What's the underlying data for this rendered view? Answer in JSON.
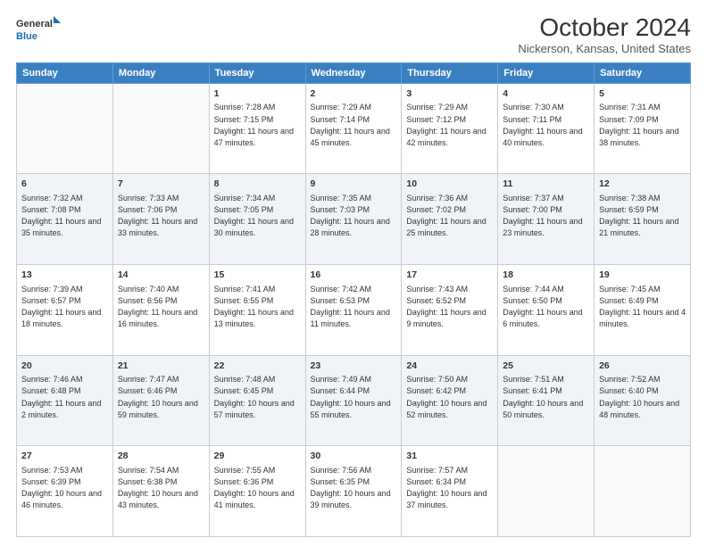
{
  "header": {
    "logo_line1": "General",
    "logo_line2": "Blue",
    "title": "October 2024",
    "subtitle": "Nickerson, Kansas, United States"
  },
  "weekdays": [
    "Sunday",
    "Monday",
    "Tuesday",
    "Wednesday",
    "Thursday",
    "Friday",
    "Saturday"
  ],
  "weeks": [
    [
      {
        "day": "",
        "info": ""
      },
      {
        "day": "",
        "info": ""
      },
      {
        "day": "1",
        "info": "Sunrise: 7:28 AM\nSunset: 7:15 PM\nDaylight: 11 hours and 47 minutes."
      },
      {
        "day": "2",
        "info": "Sunrise: 7:29 AM\nSunset: 7:14 PM\nDaylight: 11 hours and 45 minutes."
      },
      {
        "day": "3",
        "info": "Sunrise: 7:29 AM\nSunset: 7:12 PM\nDaylight: 11 hours and 42 minutes."
      },
      {
        "day": "4",
        "info": "Sunrise: 7:30 AM\nSunset: 7:11 PM\nDaylight: 11 hours and 40 minutes."
      },
      {
        "day": "5",
        "info": "Sunrise: 7:31 AM\nSunset: 7:09 PM\nDaylight: 11 hours and 38 minutes."
      }
    ],
    [
      {
        "day": "6",
        "info": "Sunrise: 7:32 AM\nSunset: 7:08 PM\nDaylight: 11 hours and 35 minutes."
      },
      {
        "day": "7",
        "info": "Sunrise: 7:33 AM\nSunset: 7:06 PM\nDaylight: 11 hours and 33 minutes."
      },
      {
        "day": "8",
        "info": "Sunrise: 7:34 AM\nSunset: 7:05 PM\nDaylight: 11 hours and 30 minutes."
      },
      {
        "day": "9",
        "info": "Sunrise: 7:35 AM\nSunset: 7:03 PM\nDaylight: 11 hours and 28 minutes."
      },
      {
        "day": "10",
        "info": "Sunrise: 7:36 AM\nSunset: 7:02 PM\nDaylight: 11 hours and 25 minutes."
      },
      {
        "day": "11",
        "info": "Sunrise: 7:37 AM\nSunset: 7:00 PM\nDaylight: 11 hours and 23 minutes."
      },
      {
        "day": "12",
        "info": "Sunrise: 7:38 AM\nSunset: 6:59 PM\nDaylight: 11 hours and 21 minutes."
      }
    ],
    [
      {
        "day": "13",
        "info": "Sunrise: 7:39 AM\nSunset: 6:57 PM\nDaylight: 11 hours and 18 minutes."
      },
      {
        "day": "14",
        "info": "Sunrise: 7:40 AM\nSunset: 6:56 PM\nDaylight: 11 hours and 16 minutes."
      },
      {
        "day": "15",
        "info": "Sunrise: 7:41 AM\nSunset: 6:55 PM\nDaylight: 11 hours and 13 minutes."
      },
      {
        "day": "16",
        "info": "Sunrise: 7:42 AM\nSunset: 6:53 PM\nDaylight: 11 hours and 11 minutes."
      },
      {
        "day": "17",
        "info": "Sunrise: 7:43 AM\nSunset: 6:52 PM\nDaylight: 11 hours and 9 minutes."
      },
      {
        "day": "18",
        "info": "Sunrise: 7:44 AM\nSunset: 6:50 PM\nDaylight: 11 hours and 6 minutes."
      },
      {
        "day": "19",
        "info": "Sunrise: 7:45 AM\nSunset: 6:49 PM\nDaylight: 11 hours and 4 minutes."
      }
    ],
    [
      {
        "day": "20",
        "info": "Sunrise: 7:46 AM\nSunset: 6:48 PM\nDaylight: 11 hours and 2 minutes."
      },
      {
        "day": "21",
        "info": "Sunrise: 7:47 AM\nSunset: 6:46 PM\nDaylight: 10 hours and 59 minutes."
      },
      {
        "day": "22",
        "info": "Sunrise: 7:48 AM\nSunset: 6:45 PM\nDaylight: 10 hours and 57 minutes."
      },
      {
        "day": "23",
        "info": "Sunrise: 7:49 AM\nSunset: 6:44 PM\nDaylight: 10 hours and 55 minutes."
      },
      {
        "day": "24",
        "info": "Sunrise: 7:50 AM\nSunset: 6:42 PM\nDaylight: 10 hours and 52 minutes."
      },
      {
        "day": "25",
        "info": "Sunrise: 7:51 AM\nSunset: 6:41 PM\nDaylight: 10 hours and 50 minutes."
      },
      {
        "day": "26",
        "info": "Sunrise: 7:52 AM\nSunset: 6:40 PM\nDaylight: 10 hours and 48 minutes."
      }
    ],
    [
      {
        "day": "27",
        "info": "Sunrise: 7:53 AM\nSunset: 6:39 PM\nDaylight: 10 hours and 46 minutes."
      },
      {
        "day": "28",
        "info": "Sunrise: 7:54 AM\nSunset: 6:38 PM\nDaylight: 10 hours and 43 minutes."
      },
      {
        "day": "29",
        "info": "Sunrise: 7:55 AM\nSunset: 6:36 PM\nDaylight: 10 hours and 41 minutes."
      },
      {
        "day": "30",
        "info": "Sunrise: 7:56 AM\nSunset: 6:35 PM\nDaylight: 10 hours and 39 minutes."
      },
      {
        "day": "31",
        "info": "Sunrise: 7:57 AM\nSunset: 6:34 PM\nDaylight: 10 hours and 37 minutes."
      },
      {
        "day": "",
        "info": ""
      },
      {
        "day": "",
        "info": ""
      }
    ]
  ]
}
